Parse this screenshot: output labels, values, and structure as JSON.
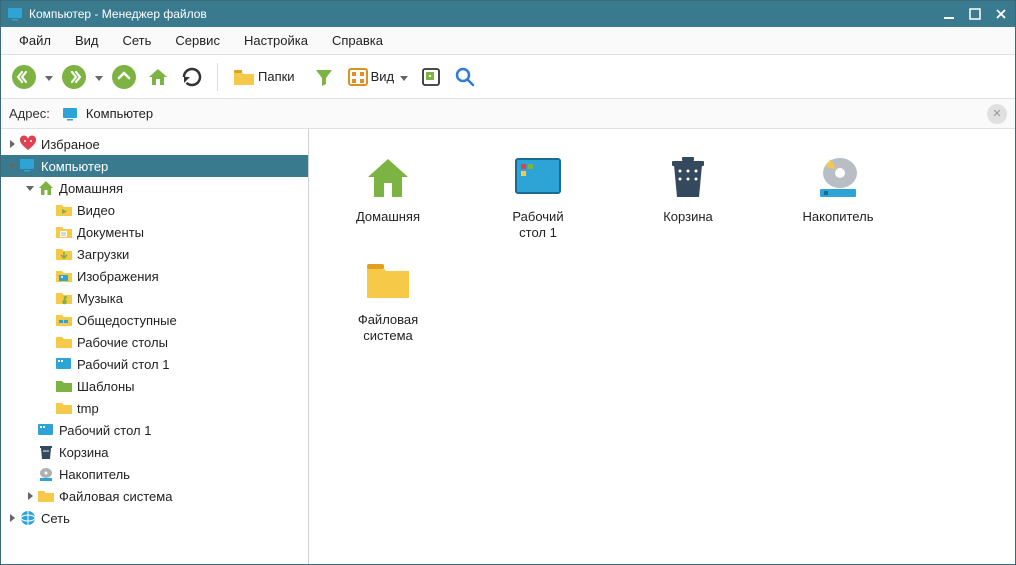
{
  "window": {
    "title": "Компьютер  - Менеджер файлов"
  },
  "menu": {
    "file": "Файл",
    "view": "Вид",
    "net": "Сеть",
    "service": "Сервис",
    "settings": "Настройка",
    "help": "Справка"
  },
  "toolbar": {
    "folders": "Папки",
    "view": "Вид"
  },
  "address": {
    "label": "Адрес:",
    "value": "Компьютер"
  },
  "tree": {
    "favorites": "Избраное",
    "computer": "Компьютер",
    "home": "Домашняя",
    "video": "Видео",
    "documents": "Документы",
    "downloads": "Загрузки",
    "pictures": "Изображения",
    "music": "Музыка",
    "public": "Общедоступные",
    "desktops": "Рабочие столы",
    "desktop1": "Рабочий стол 1",
    "templates": "Шаблоны",
    "tmp": "tmp",
    "desktop1b": "Рабочий стол 1",
    "trash": "Корзина",
    "storage": "Накопитель",
    "filesystem": "Файловая система",
    "network": "Сеть"
  },
  "content": {
    "home": "Домашняя",
    "desktop": "Рабочий\nстол 1",
    "trash": "Корзина",
    "storage": "Накопитель",
    "filesystem": "Файловая\nсистема"
  }
}
